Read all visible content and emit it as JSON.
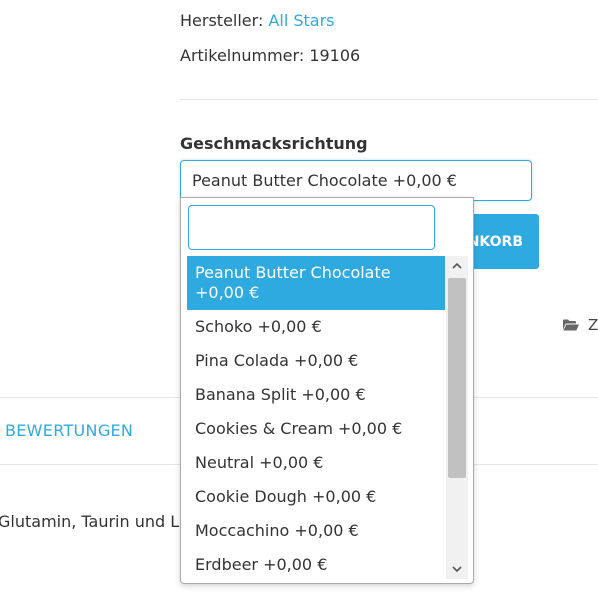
{
  "product": {
    "manufacturer_label": "Hersteller:",
    "manufacturer_value": "All Stars",
    "sku_label": "Artikelnummer:",
    "sku_value": "19106"
  },
  "variant": {
    "label": "Geschmacksrichtung",
    "selected": "Peanut Butter Chocolate +0,00 €"
  },
  "cart_button": {
    "label": "IN DEN WARENKORB",
    "visible_label": "NKORB"
  },
  "folder_link": {
    "icon": "folder-open-icon",
    "label": "Z"
  },
  "tabs": {
    "reviews": "BEWERTUNGEN"
  },
  "description": {
    "text": "Glutamin, Taurin und L"
  },
  "dropdown": {
    "search_value": "",
    "options": [
      "Peanut Butter Chocolate +0,00 €",
      "Schoko +0,00 €",
      "Pina Colada +0,00 €",
      "Banana Split +0,00 €",
      "Cookies & Cream +0,00 €",
      "Neutral +0,00 €",
      "Cookie Dough +0,00 €",
      "Moccachino +0,00 €",
      "Erdbeer +0,00 €"
    ],
    "selected_index": 0,
    "scrollbar": {
      "up_icon": "chevron-up-icon",
      "down_icon": "chevron-down-icon"
    }
  },
  "colors": {
    "accent": "#2eaae1",
    "text": "#333333",
    "divider": "#e5e5e5",
    "scrollbar_track": "#f1f1f1",
    "scrollbar_thumb": "#c1c1c1"
  }
}
